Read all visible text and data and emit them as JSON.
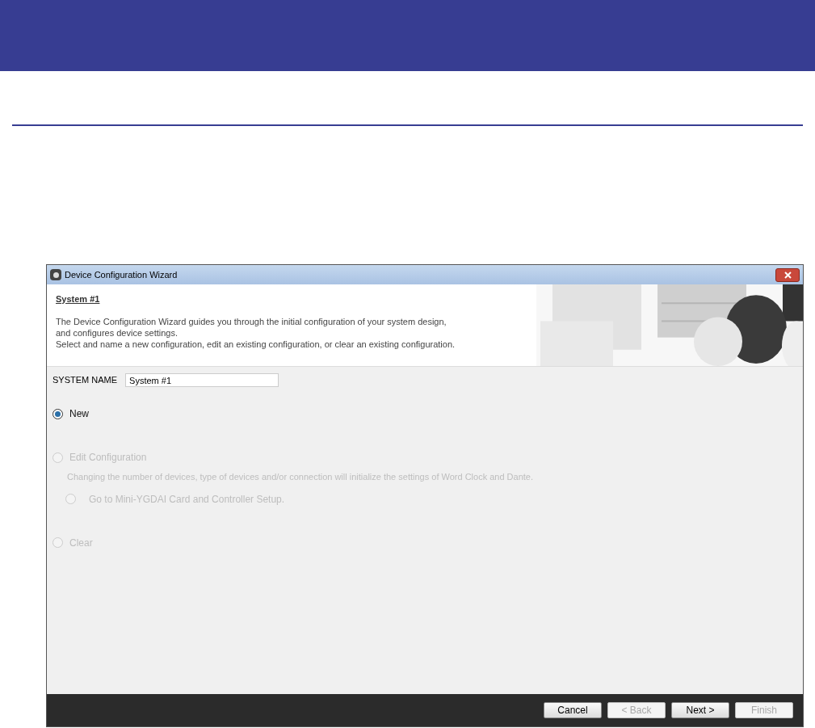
{
  "window": {
    "title": "Device Configuration Wizard"
  },
  "header": {
    "heading": "System #1",
    "description": [
      "The Device Configuration Wizard guides you through the initial configuration of your system design,",
      "and configures device settings.",
      "Select and name a new configuration, edit an existing configuration, or clear an existing configuration."
    ]
  },
  "system_name": {
    "label": "SYSTEM NAME",
    "value": "System #1"
  },
  "options": [
    {
      "label": "New",
      "selected": true,
      "disabled": false
    },
    {
      "label": "Edit Configuration",
      "selected": false,
      "disabled": true,
      "note": "Changing the number of devices, type of devices and/or connection will initialize the settings of Word Clock and Dante.",
      "children": [
        {
          "label": "Go to Mini-YGDAI Card and Controller Setup.",
          "selected": false,
          "disabled": true
        }
      ]
    },
    {
      "label": "Clear",
      "selected": false,
      "disabled": true
    }
  ],
  "buttons": [
    {
      "label": "Cancel",
      "disabled": false
    },
    {
      "label": "< Back",
      "disabled": true
    },
    {
      "label": "Next >",
      "disabled": false
    },
    {
      "label": "Finish",
      "disabled": true
    }
  ]
}
